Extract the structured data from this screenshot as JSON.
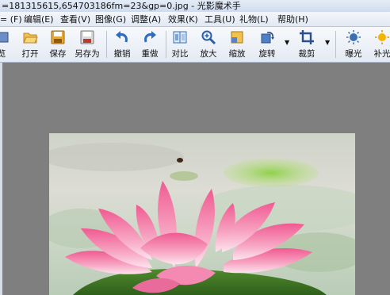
{
  "window": {
    "title": "=181315615,654703186fm=23&gp=0.jpg - 光影魔术手"
  },
  "menu": {
    "items": [
      {
        "label": "= (F)"
      },
      {
        "label": "编辑(E)"
      },
      {
        "label": "查看(V)"
      },
      {
        "label": "图像(G)"
      },
      {
        "label": "调整(A)"
      },
      {
        "label": "效果(K)"
      },
      {
        "label": "工具(U)"
      },
      {
        "label": "礼物(L)"
      },
      {
        "label": "帮助(H)"
      }
    ]
  },
  "toolbar": {
    "items": [
      {
        "label": "览",
        "icon": "browse-icon"
      },
      {
        "label": "打开",
        "icon": "folder-open-icon"
      },
      {
        "label": "保存",
        "icon": "save-icon"
      },
      {
        "label": "另存为",
        "icon": "save-as-icon"
      },
      {
        "label": "撤销",
        "icon": "undo-icon"
      },
      {
        "label": "重做",
        "icon": "redo-icon"
      },
      {
        "label": "对比",
        "icon": "compare-icon"
      },
      {
        "label": "放大",
        "icon": "zoom-in-icon"
      },
      {
        "label": "缩放",
        "icon": "resize-icon"
      },
      {
        "label": "旋转",
        "icon": "rotate-icon"
      },
      {
        "label": "裁剪",
        "icon": "crop-icon"
      },
      {
        "label": "曝光",
        "icon": "exposure-icon"
      },
      {
        "label": "补光",
        "icon": "fill-light-icon"
      }
    ]
  },
  "image": {
    "subject": "lotus flower photo"
  }
}
